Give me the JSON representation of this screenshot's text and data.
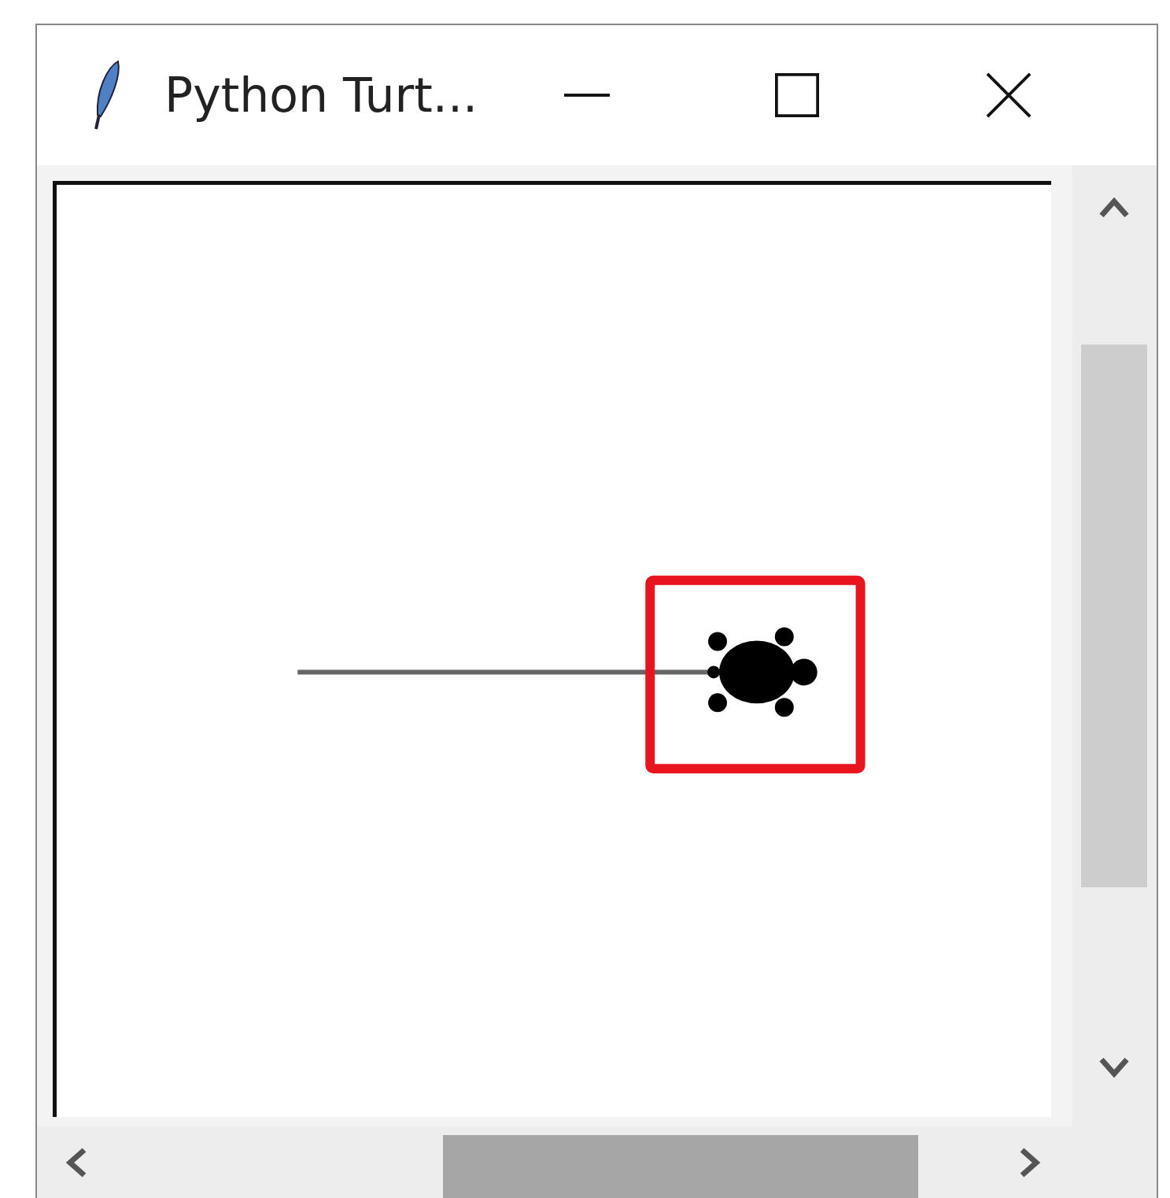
{
  "window": {
    "title": "Python Turt..."
  }
}
